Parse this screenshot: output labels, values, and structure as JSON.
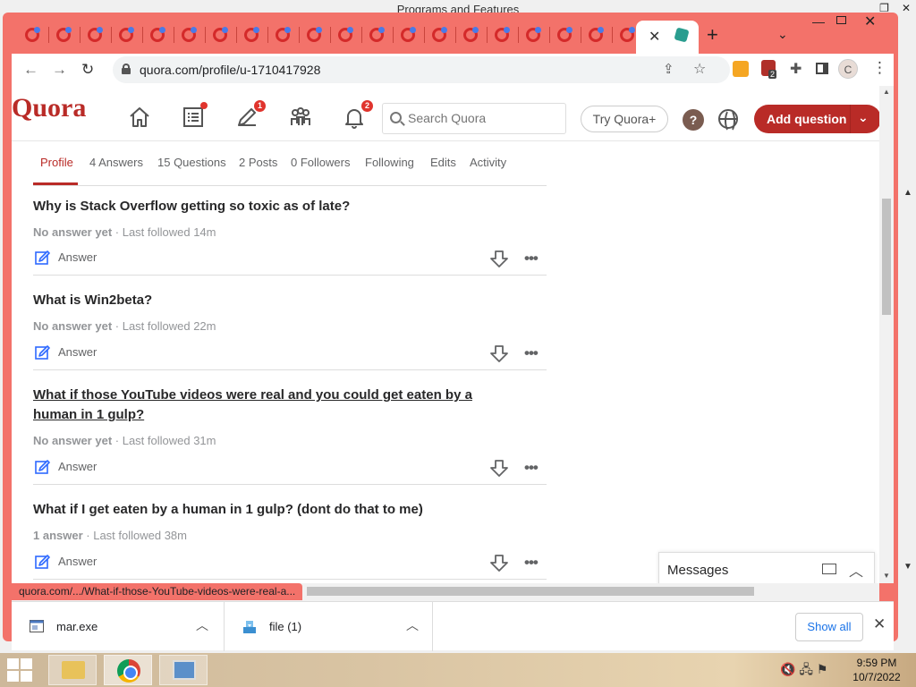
{
  "background_window": {
    "title": "Programs and Features"
  },
  "browser": {
    "url": "quora.com/profile/u-1710417928",
    "status_text": "quora.com/.../What-if-those-YouTube-videos-were-real-a...",
    "profile_initial": "C",
    "extension_badge": "2"
  },
  "quora": {
    "logo": "Quora",
    "answers_badge": "1",
    "notifications_badge": "2",
    "search_placeholder": "Search Quora",
    "try_plus": "Try Quora+",
    "help_label": "?",
    "add_question": "Add question",
    "tabs": [
      {
        "label": "Profile"
      },
      {
        "label": "4 Answers"
      },
      {
        "label": "15 Questions"
      },
      {
        "label": "2 Posts"
      },
      {
        "label": "0 Followers"
      },
      {
        "label": "Following"
      },
      {
        "label": "Edits"
      },
      {
        "label": "Activity"
      }
    ],
    "questions": [
      {
        "title": "Why is Stack Overflow getting so toxic as of late?",
        "status": "No answer yet",
        "followed": " · Last followed 14m",
        "answer_label": "Answer"
      },
      {
        "title": "What is Win2beta?",
        "status": "No answer yet",
        "followed": " · Last followed 22m",
        "answer_label": "Answer"
      },
      {
        "title": "What if those YouTube videos were real and you could get eaten by a human in 1 gulp?",
        "status": "No answer yet",
        "followed": " · Last followed 31m",
        "answer_label": "Answer"
      },
      {
        "title": "What if I get eaten by a human in 1 gulp? (dont do that to me)",
        "status": "1 answer",
        "followed": " · Last followed 38m",
        "answer_label": "Answer"
      }
    ],
    "messages_label": "Messages"
  },
  "downloads": {
    "items": [
      {
        "name": "mar.exe"
      },
      {
        "name": "file (1)"
      }
    ],
    "show_all": "Show all"
  },
  "taskbar": {
    "time": "9:59 PM",
    "date": "10/7/2022"
  },
  "colors": {
    "quora_red": "#b92b27",
    "chrome_frame": "#f3726a"
  }
}
